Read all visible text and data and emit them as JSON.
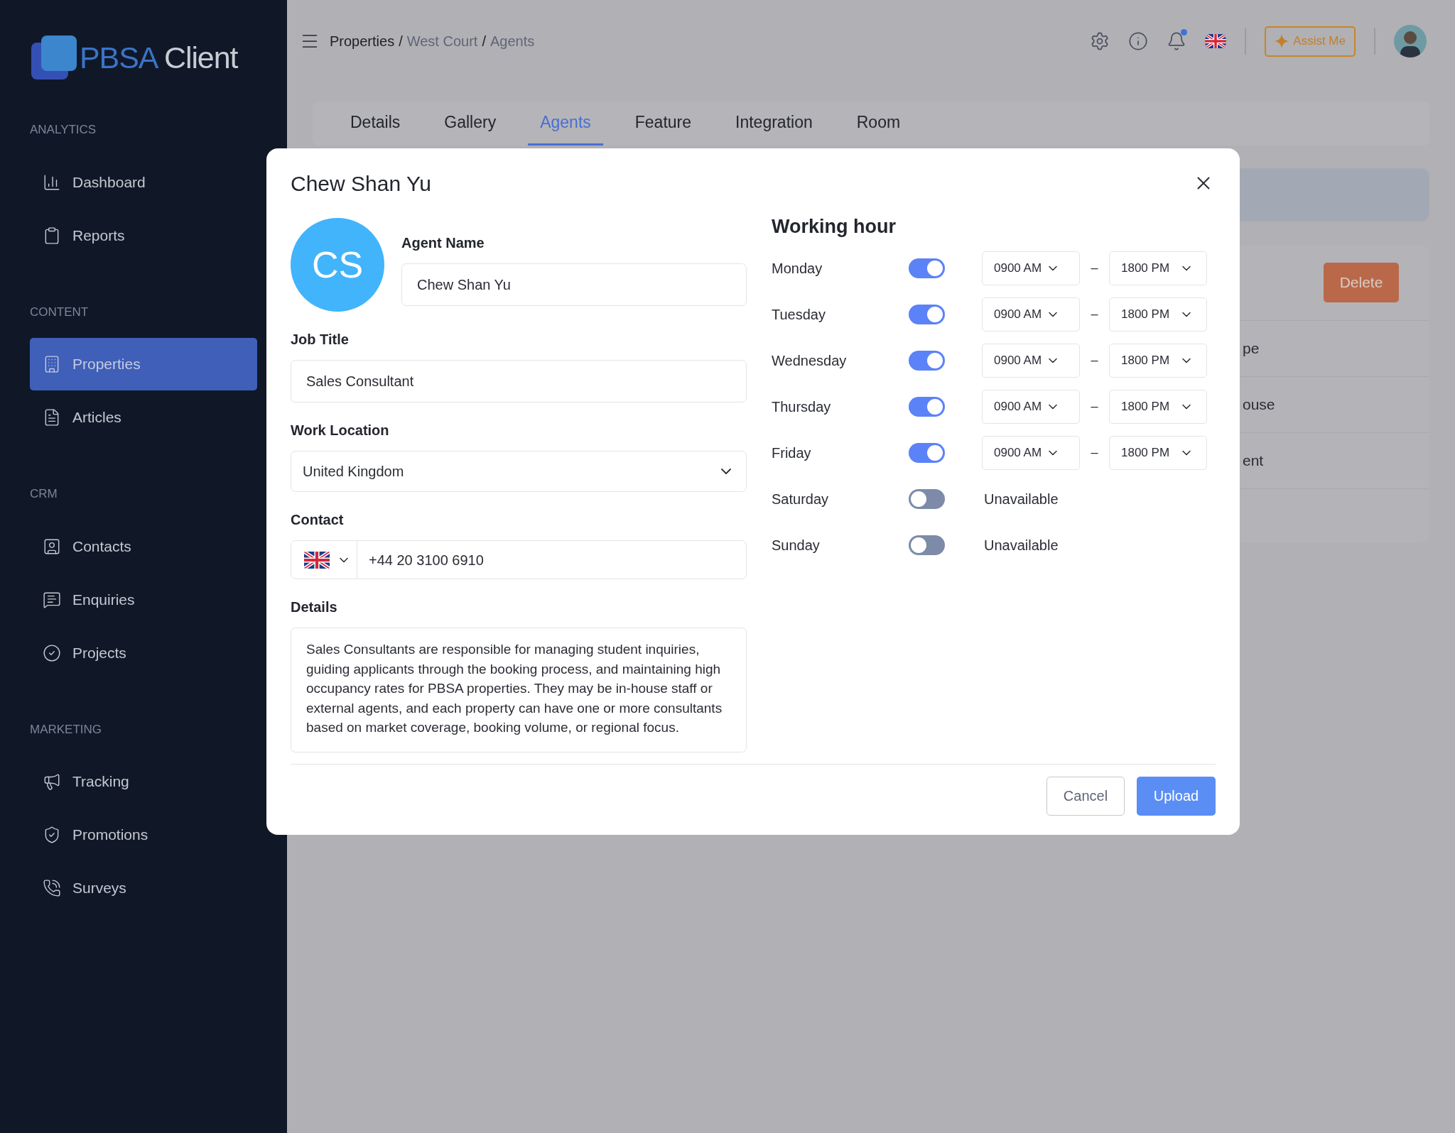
{
  "sidebar": {
    "logo": {
      "brand": "PBSA",
      "product": "Client"
    },
    "sections": [
      {
        "title": "ANALYTICS",
        "items": [
          {
            "label": "Dashboard",
            "selected": false
          },
          {
            "label": "Reports",
            "selected": false
          }
        ]
      },
      {
        "title": "CONTENT",
        "items": [
          {
            "label": "Properties",
            "selected": true
          },
          {
            "label": "Articles",
            "selected": false
          }
        ]
      },
      {
        "title": "CRM",
        "items": [
          {
            "label": "Contacts",
            "selected": false
          },
          {
            "label": "Enquiries",
            "selected": false
          },
          {
            "label": "Projects",
            "selected": false
          }
        ]
      },
      {
        "title": "MARKETING",
        "items": [
          {
            "label": "Tracking",
            "selected": false
          },
          {
            "label": "Promotions",
            "selected": false
          },
          {
            "label": "Surveys",
            "selected": false
          }
        ]
      }
    ]
  },
  "header": {
    "breadcrumb": [
      {
        "kind": "root",
        "label": "Properties"
      },
      {
        "kind": "sep",
        "label": "/"
      },
      {
        "kind": "link",
        "label": "West Court"
      },
      {
        "kind": "sep",
        "label": "/"
      },
      {
        "kind": "link",
        "label": "Agents"
      }
    ],
    "notification_unread": true,
    "assist_button": "Assist Me"
  },
  "tabs": [
    {
      "label": "Details",
      "selected": false
    },
    {
      "label": "Gallery",
      "selected": false
    },
    {
      "label": "Agents",
      "selected": true
    },
    {
      "label": "Feature",
      "selected": false
    },
    {
      "label": "Integration",
      "selected": false
    },
    {
      "label": "Room",
      "selected": false
    }
  ],
  "background_card": {
    "delete_button": "Delete",
    "rows": [
      "pe",
      "ouse",
      "ent"
    ]
  },
  "modal": {
    "title": "Chew Shan Yu",
    "avatar_initials": "CS",
    "agent_name": {
      "label": "Agent Name",
      "value": "Chew Shan Yu"
    },
    "job_title": {
      "label": "Job Title",
      "value": "Sales Consultant"
    },
    "work_location": {
      "label": "Work Location",
      "value": "United Kingdom"
    },
    "contact": {
      "label": "Contact",
      "value": "+44 20 3100 6910"
    },
    "details": {
      "label": "Details",
      "value": "Sales Consultants are responsible for managing student inquiries, guiding applicants through the booking process, and maintaining high occupancy rates for PBSA properties. They may be in-house staff or external agents, and each property can have one or more consultants based on market coverage, booking volume, or regional focus."
    },
    "working_hours": {
      "title": "Working hour",
      "days": [
        {
          "day": "Monday",
          "on": true,
          "start": "0900 AM",
          "separator": "–",
          "end": "1800 PM"
        },
        {
          "day": "Tuesday",
          "on": true,
          "start": "0900 AM",
          "separator": "–",
          "end": "1800 PM"
        },
        {
          "day": "Wednesday",
          "on": true,
          "start": "0900 AM",
          "separator": "–",
          "end": "1800 PM"
        },
        {
          "day": "Thursday",
          "on": true,
          "start": "0900 AM",
          "separator": "–",
          "end": "1800 PM"
        },
        {
          "day": "Friday",
          "on": true,
          "start": "0900 AM",
          "separator": "–",
          "end": "1800 PM"
        },
        {
          "day": "Saturday",
          "on": false,
          "status": "Unavailable"
        },
        {
          "day": "Sunday",
          "on": false,
          "status": "Unavailable"
        }
      ]
    },
    "buttons": {
      "cancel": "Cancel",
      "upload": "Upload"
    }
  }
}
